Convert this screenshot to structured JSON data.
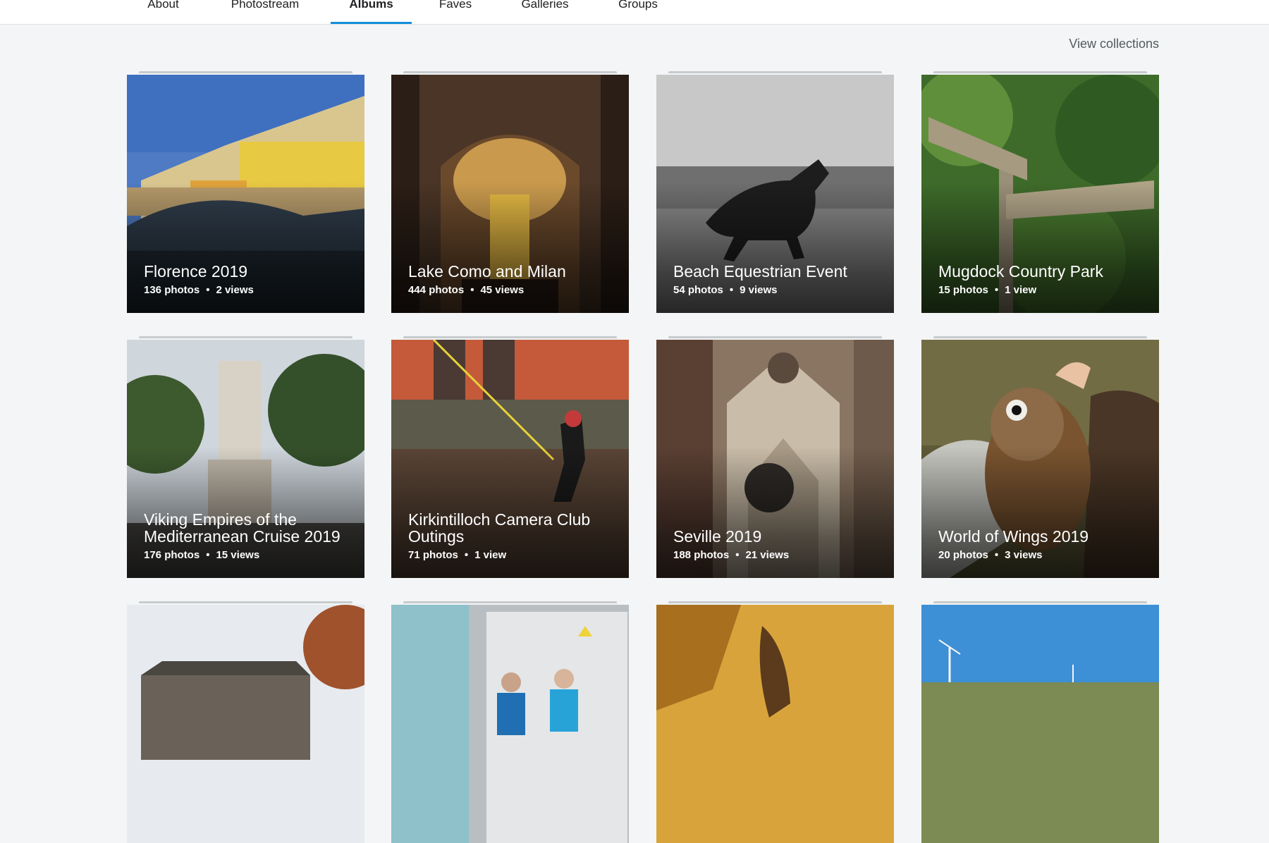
{
  "tabs": [
    {
      "label": "About",
      "active": false
    },
    {
      "label": "Photostream",
      "active": false
    },
    {
      "label": "Albums",
      "active": true
    },
    {
      "label": "Faves",
      "active": false
    },
    {
      "label": "Galleries",
      "active": false
    },
    {
      "label": "Groups",
      "active": false
    }
  ],
  "view_collections_label": "View collections",
  "separator": "•",
  "albums": [
    {
      "title": "Florence 2019",
      "photos": "136 photos",
      "views": "2 views"
    },
    {
      "title": "Lake Como and Milan",
      "photos": "444 photos",
      "views": "45 views"
    },
    {
      "title": "Beach Equestrian Event",
      "photos": "54 photos",
      "views": "9 views"
    },
    {
      "title": "Mugdock Country Park",
      "photos": "15 photos",
      "views": "1 view"
    },
    {
      "title": "Viking Empires of the Mediterranean Cruise 2019",
      "photos": "176 photos",
      "views": "15 views"
    },
    {
      "title": "Kirkintilloch Camera Club Outings",
      "photos": "71 photos",
      "views": "1 view"
    },
    {
      "title": "Seville 2019",
      "photos": "188 photos",
      "views": "21 views"
    },
    {
      "title": "World of Wings 2019",
      "photos": "20 photos",
      "views": "3 views"
    },
    {
      "title": "",
      "photos": "",
      "views": ""
    },
    {
      "title": "",
      "photos": "",
      "views": ""
    },
    {
      "title": "",
      "photos": "",
      "views": ""
    },
    {
      "title": "",
      "photos": "",
      "views": ""
    }
  ],
  "colors": {
    "accent": "#128fdc",
    "background": "#f3f5f6"
  }
}
